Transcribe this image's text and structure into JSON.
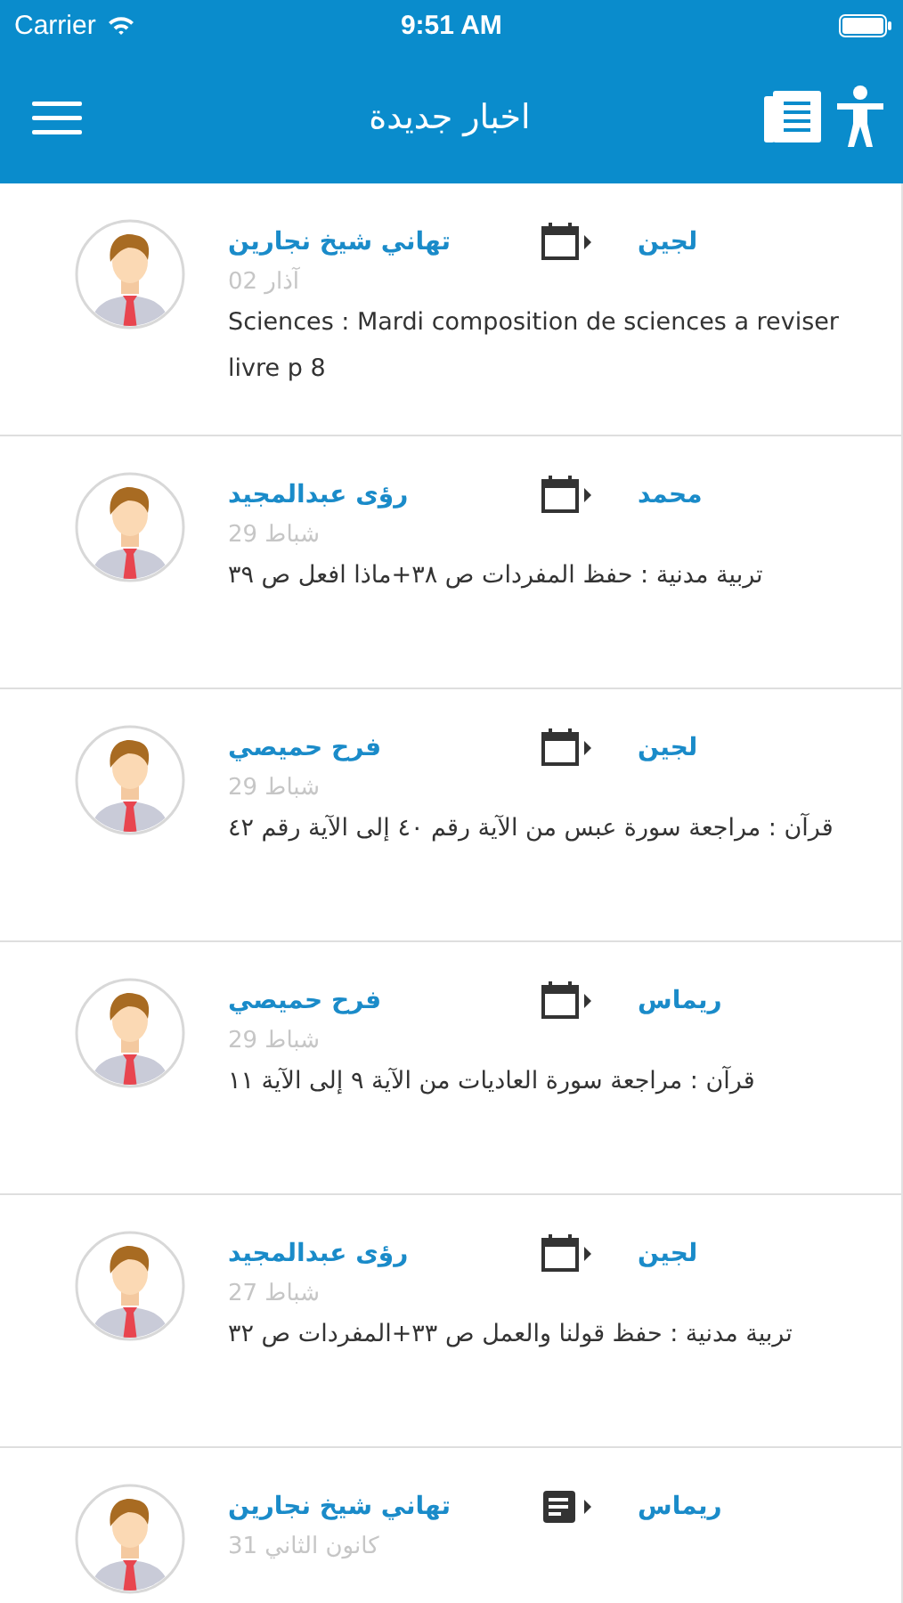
{
  "status_bar": {
    "carrier": "Carrier",
    "time": "9:51 AM"
  },
  "nav_bar": {
    "title": "اخبار جديدة"
  },
  "news": [
    {
      "sender": "تهاني شيخ نجارين",
      "kind": "calendar",
      "recipient": "لجين",
      "date": "آذار 02",
      "message": "Sciences : Mardi composition de sciences a reviser livre p 8"
    },
    {
      "sender": "رؤى عبدالمجيد",
      "kind": "calendar",
      "recipient": "محمد",
      "date": "شباط 29",
      "message": "تربية مدنية : حفظ المفردات ص ٣٨+ماذا افعل ص ٣٩"
    },
    {
      "sender": "فرح حميصي",
      "kind": "calendar",
      "recipient": "لجين",
      "date": "شباط 29",
      "message": "قرآن : مراجعة سورة عبس من الآية رقم ٤٠ إلى الآية رقم ٤٢"
    },
    {
      "sender": "فرح حميصي",
      "kind": "calendar",
      "recipient": "ريماس",
      "date": "شباط 29",
      "message": "قرآن : مراجعة سورة العاديات من الآية ٩ إلى الآية ١١"
    },
    {
      "sender": "رؤى عبدالمجيد",
      "kind": "calendar",
      "recipient": "لجين",
      "date": "شباط 27",
      "message": "تربية مدنية : حفظ قولنا والعمل ص ٣٣+المفردات ص ٣٢"
    },
    {
      "sender": "تهاني شيخ نجارين",
      "kind": "note",
      "recipient": "ريماس",
      "date": "كانون الثاني 31"
    }
  ]
}
